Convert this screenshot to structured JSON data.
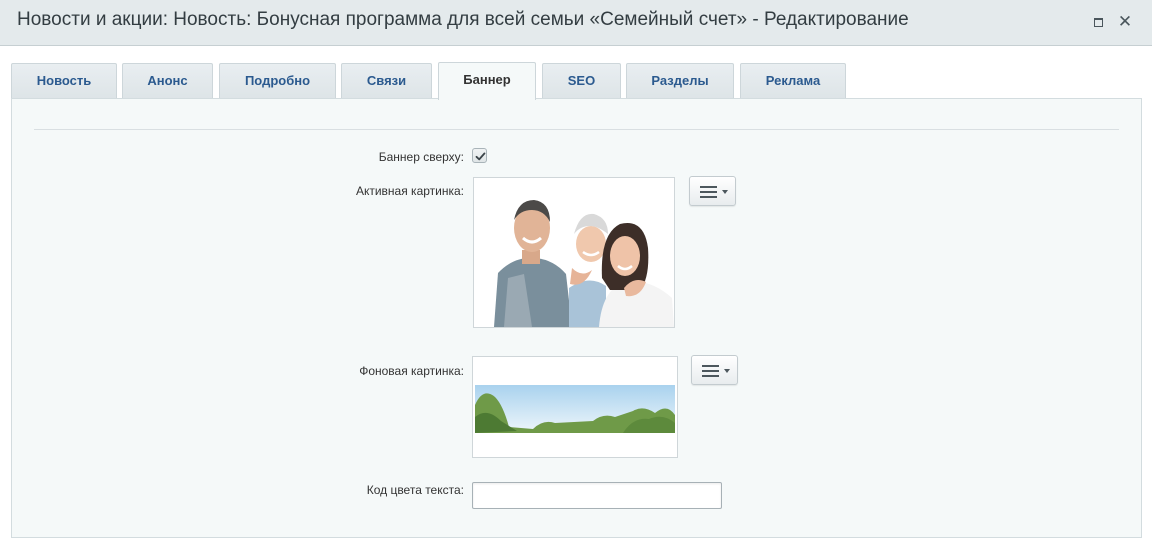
{
  "window": {
    "title": "Новости и акции: Новость: Бонусная программа для всей семьи «Семейный счет» - Редактирование",
    "close_glyph": "✕"
  },
  "tabs": [
    {
      "label": "Новость",
      "active": false
    },
    {
      "label": "Анонс",
      "active": false
    },
    {
      "label": "Подробно",
      "active": false
    },
    {
      "label": "Связи",
      "active": false
    },
    {
      "label": "Баннер",
      "active": true
    },
    {
      "label": "SEO",
      "active": false
    },
    {
      "label": "Разделы",
      "active": false
    },
    {
      "label": "Реклама",
      "active": false
    }
  ],
  "form": {
    "banner_top_label": "Баннер сверху:",
    "banner_top_checked": true,
    "active_image_label": "Активная картинка:",
    "background_image_label": "Фоновая картинка:",
    "text_color_label": "Код цвета текста:",
    "text_color_value": ""
  },
  "colors": {
    "tab_text": "#2b5a8f",
    "panel_bg": "#f5f9f9",
    "titlebar_bg": "#e4eaec"
  },
  "icons": {
    "menu": "hamburger-menu-icon",
    "maximize": "maximize-icon",
    "close": "close-icon",
    "check": "checkmark-icon"
  }
}
